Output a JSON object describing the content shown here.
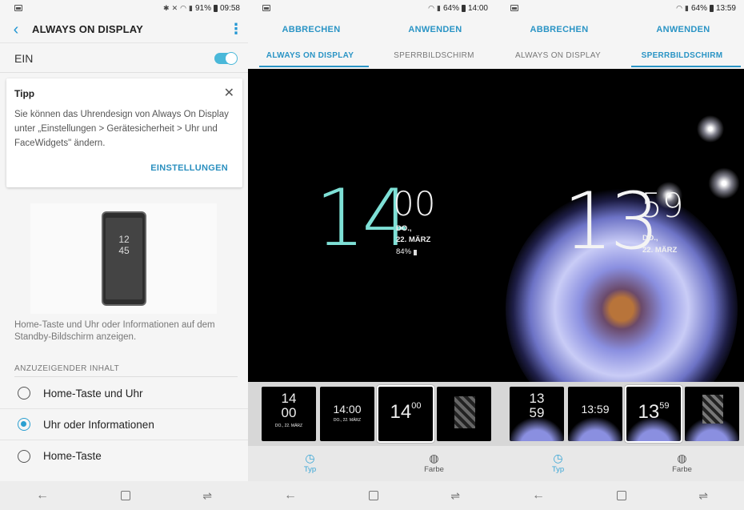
{
  "screen1": {
    "status": {
      "battery_pct": "91%",
      "time": "09:58"
    },
    "title": "ALWAYS ON DISPLAY",
    "toggle_label": "EIN",
    "toggle_on": true,
    "tip": {
      "title": "Tipp",
      "text": "Sie können das Uhrendesign von Always On Display unter „Einstellungen > Gerätesicherheit > Uhr und FaceWidgets\" ändern.",
      "link": "EINSTELLUNGEN"
    },
    "preview_clock": {
      "hour": "12",
      "minute": "45"
    },
    "description": "Home-Taste und Uhr oder Informationen auf dem Standby-Bildschirm anzeigen.",
    "section_header": "ANZUZEIGENDER INHALT",
    "options": [
      {
        "label": "Home-Taste und Uhr",
        "selected": false
      },
      {
        "label": "Uhr oder Informationen",
        "selected": true
      },
      {
        "label": "Home-Taste",
        "selected": false
      }
    ]
  },
  "screen2": {
    "status": {
      "battery_pct": "64%",
      "time": "14:00"
    },
    "cancel": "ABBRECHEN",
    "apply": "ANWENDEN",
    "tabs": [
      "ALWAYS ON DISPLAY",
      "SPERRBILDSCHIRM"
    ],
    "active_tab": 0,
    "clock": {
      "hour": "14",
      "minute": "00",
      "day": "DO.,",
      "date": "22. MÄRZ",
      "battery": "84%"
    },
    "thumbs": [
      {
        "line1": "14",
        "line2": "00",
        "sub": "DO., 22. MÄRZ"
      },
      {
        "line1": "14:00",
        "line2": "",
        "sub": "DO., 22. MÄRZ"
      },
      {
        "line1": "14",
        "line2": "00",
        "sub": ""
      },
      {
        "line1": "",
        "line2": "",
        "sub": ""
      }
    ],
    "bottom_tabs": [
      {
        "icon": "clock-icon",
        "label": "Typ"
      },
      {
        "icon": "palette-icon",
        "label": "Farbe"
      }
    ],
    "colors": {
      "accent": "#2a94c5",
      "clock": "#7ee0d6"
    }
  },
  "screen3": {
    "status": {
      "battery_pct": "64%",
      "time": "13:59"
    },
    "cancel": "ABBRECHEN",
    "apply": "ANWENDEN",
    "tabs": [
      "ALWAYS ON DISPLAY",
      "SPERRBILDSCHIRM"
    ],
    "active_tab": 1,
    "clock": {
      "hour": "13",
      "minute": "59",
      "day": "DO.,",
      "date": "22. MÄRZ"
    },
    "thumbs": [
      {
        "line1": "13",
        "line2": "59",
        "sub": ""
      },
      {
        "line1": "13:59",
        "line2": "",
        "sub": ""
      },
      {
        "line1": "13",
        "line2": "59",
        "sub": ""
      },
      {
        "line1": "",
        "line2": "",
        "sub": ""
      }
    ],
    "bottom_tabs": [
      {
        "icon": "clock-icon",
        "label": "Typ"
      },
      {
        "icon": "palette-icon",
        "label": "Farbe"
      }
    ]
  }
}
